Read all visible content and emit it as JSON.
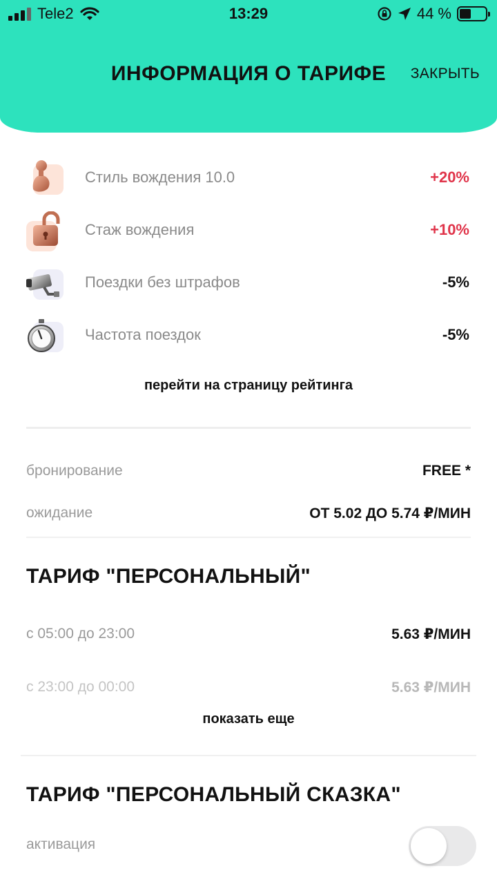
{
  "status_bar": {
    "carrier": "Tele2",
    "time": "13:29",
    "battery_percent": "44 %",
    "battery_level": 0.44,
    "icons": [
      "signal-icon",
      "wifi-icon",
      "rotation-lock-icon",
      "location-arrow-icon",
      "battery-icon"
    ]
  },
  "header": {
    "title": "ИНФОРМАЦИЯ О ТАРИФЕ",
    "close_label": "ЗАКРЫТЬ",
    "bg_color": "#2de2bd"
  },
  "factors": [
    {
      "label": "Стиль вождения 10.0",
      "value": "+20%",
      "icon": "driver-figure-icon",
      "value_color": "#e0344a"
    },
    {
      "label": "Стаж вождения",
      "value": "+10%",
      "icon": "padlock-icon",
      "value_color": "#e0344a"
    },
    {
      "label": "Поездки без штрафов",
      "value": "-5%",
      "icon": "camera-icon",
      "value_color": "#111111"
    },
    {
      "label": "Частота поездок",
      "value": "-5%",
      "icon": "stopwatch-icon",
      "value_color": "#111111"
    }
  ],
  "rating_link": "перейти на страницу рейтинга",
  "booking": {
    "label": "бронирование",
    "value": "FREE *"
  },
  "waiting": {
    "label": "ожидание",
    "value": "ОТ 5.02 ДО 5.74 ₽/МИН"
  },
  "tariff_personal": {
    "title": "ТАРИФ \"ПЕРСОНАЛЬНЫЙ\"",
    "rows": [
      {
        "label": "с 05:00 до 23:00",
        "value": "5.63 ₽/МИН"
      },
      {
        "label": "с 23:00 до 00:00",
        "value": "5.63 ₽/МИН"
      }
    ],
    "show_more": "показать еще"
  },
  "tariff_skazka": {
    "title": "ТАРИФ \"ПЕРСОНАЛЬНЫЙ СКАЗКА\"",
    "activation_label": "активация",
    "activation_on": false
  }
}
